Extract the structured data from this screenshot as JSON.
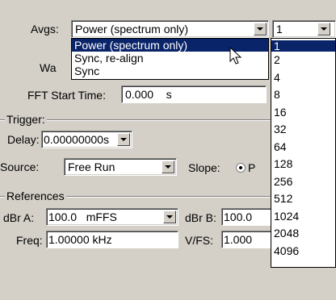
{
  "avgs": {
    "label": "Avgs:",
    "mode_value": "Power (spectrum only)",
    "count_value": "1",
    "mode_options": [
      "Power (spectrum only)",
      "Sync, re-align",
      "Sync"
    ],
    "count_options": [
      "1",
      "2",
      "4",
      "8",
      "16",
      "32",
      "64",
      "128",
      "256",
      "512",
      "1024",
      "2048",
      "4096"
    ]
  },
  "window": {
    "label_partial": "Wa"
  },
  "fft": {
    "label": "FFT Start Time:",
    "value": "0.000",
    "unit": "s"
  },
  "trigger": {
    "group_title": "Trigger:",
    "delay_label": "Delay:",
    "delay_value": "0.00000000s",
    "source_label": "Source:",
    "source_value": "Free Run",
    "slope_label": "Slope:",
    "slope_option_partial": "P"
  },
  "references": {
    "group_title": "References",
    "dbra_label": "dBr A:",
    "dbra_value": "100.0   mFFS",
    "dbrb_label": "dBr B:",
    "dbrb_value": "100.0",
    "freq_label": "Freq:",
    "freq_value": "1.00000 kHz",
    "vfs_label": "V/FS:",
    "vfs_value": "1.000"
  },
  "colors": {
    "face": "#d4d0c8",
    "highlight": "#0a246a"
  }
}
